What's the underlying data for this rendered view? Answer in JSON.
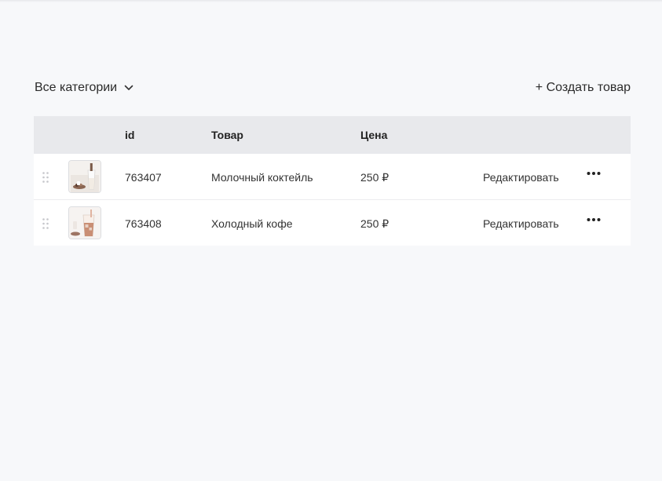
{
  "toolbar": {
    "category_label": "Все категории",
    "create_label": "+ Создать товар"
  },
  "table": {
    "headers": {
      "id": "id",
      "name": "Товар",
      "price": "Цена"
    },
    "rows": [
      {
        "id": "763407",
        "name": "Молочный коктейль",
        "price": "250 ₽",
        "edit_label": "Редактировать"
      },
      {
        "id": "763408",
        "name": "Холодный кофе",
        "price": "250 ₽",
        "edit_label": "Редактировать"
      }
    ]
  },
  "icons": {
    "category_dropdown": "chevron-down-icon",
    "drag_handle": "drag-handle-icon",
    "more": "more-horizontal-icon"
  }
}
